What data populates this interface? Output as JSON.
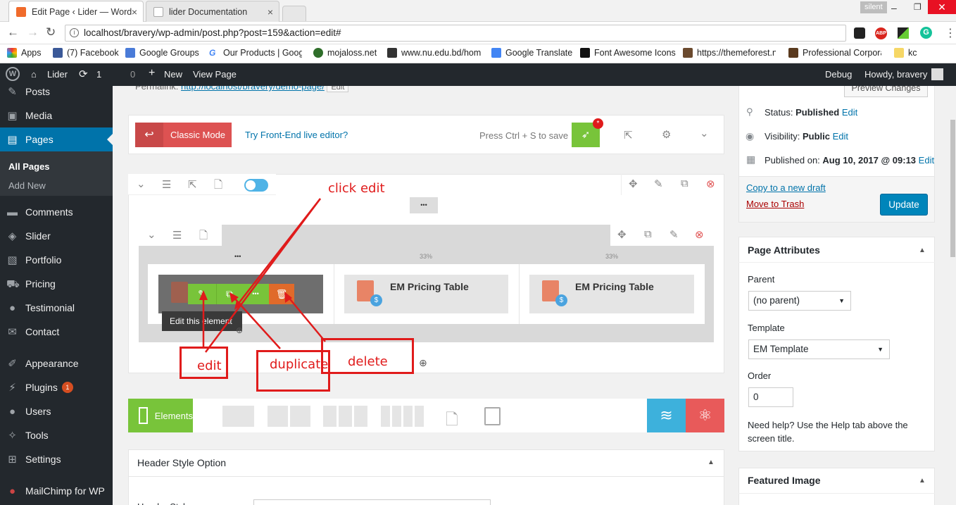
{
  "browser": {
    "tabs": [
      {
        "title": "Edit Page ‹ Lider — Word",
        "close": "×"
      },
      {
        "title": "lider Documentation",
        "close": "×"
      }
    ],
    "profile": "silent",
    "url": "localhost/bravery/wp-admin/post.php?post=159&action=edit#",
    "bookmarks": [
      "Apps",
      "(7) Facebook",
      "Google Groups",
      "Our Products | Googl",
      "mojaloss.net",
      "www.nu.edu.bd/hom",
      "Google Translate",
      "Font Awesome Icons",
      "https://themeforest.n",
      "Professional Corpora",
      "kc"
    ]
  },
  "adminbar": {
    "site": "Lider",
    "updates": "1",
    "comments": "0",
    "new": "New",
    "view": "View Page",
    "debug": "Debug",
    "howdy": "Howdy, bravery"
  },
  "sidebar": {
    "items": [
      {
        "label": "Posts",
        "icon": "pin-icon"
      },
      {
        "label": "Media",
        "icon": "media-icon"
      },
      {
        "label": "Pages",
        "icon": "pages-icon"
      },
      {
        "label": "Comments",
        "icon": "comments-icon"
      },
      {
        "label": "Slider",
        "icon": "slider-icon"
      },
      {
        "label": "Portfolio",
        "icon": "portfolio-icon"
      },
      {
        "label": "Pricing",
        "icon": "cart-icon"
      },
      {
        "label": "Testimonial",
        "icon": "speech-icon"
      },
      {
        "label": "Contact",
        "icon": "mail-icon"
      },
      {
        "label": "Appearance",
        "icon": "brush-icon"
      },
      {
        "label": "Plugins",
        "icon": "plug-icon"
      },
      {
        "label": "Users",
        "icon": "user-icon"
      },
      {
        "label": "Tools",
        "icon": "wrench-icon"
      },
      {
        "label": "Settings",
        "icon": "settings-icon"
      },
      {
        "label": "MailChimp for WP",
        "icon": "mailchimp-icon"
      }
    ],
    "plugins_badge": "1",
    "sub_all": "All Pages",
    "sub_add": "Add New"
  },
  "editor": {
    "permalink_label": "Permalink:",
    "permalink_url": "http://localhost/bravery/demo-page/",
    "permalink_edit": "Edit",
    "classic_mode": "Classic Mode",
    "frontend": "Try Front-End live editor?",
    "save_hint": "Press Ctrl + S to save",
    "badge": "*",
    "col_pct_1": "33%",
    "col_pct_2": "33%",
    "element_title": "EM Pricing Table",
    "element_title_2": "EM Pricing Table",
    "tooltip": "Edit this element",
    "elements_label": "Elements",
    "header_option": "Header Style Option",
    "header_style": "Header Style",
    "dots": "•••"
  },
  "annotations": {
    "click_edit": "click edit",
    "edit": "edit",
    "duplicate": "duplicate",
    "delete": "delete"
  },
  "publish": {
    "preview": "Preview Changes",
    "status_label": "Status:",
    "status_value": "Published",
    "visibility_label": "Visibility:",
    "visibility_value": "Public",
    "published_label": "Published on:",
    "published_value": "Aug 10, 2017 @ 09:13",
    "edit": "Edit",
    "copy_draft": "Copy to a new draft",
    "trash": "Move to Trash",
    "update": "Update"
  },
  "page_attributes": {
    "title": "Page Attributes",
    "parent_label": "Parent",
    "parent_value": "(no parent)",
    "template_label": "Template",
    "template_value": "EM Template",
    "order_label": "Order",
    "order_value": "0",
    "help": "Need help? Use the Help tab above the screen title."
  },
  "featured": {
    "title": "Featured Image"
  },
  "colors": {
    "accent": "#0073aa",
    "red": "#dd5252",
    "green": "#78c43a",
    "annotation": "#e01b1b"
  }
}
